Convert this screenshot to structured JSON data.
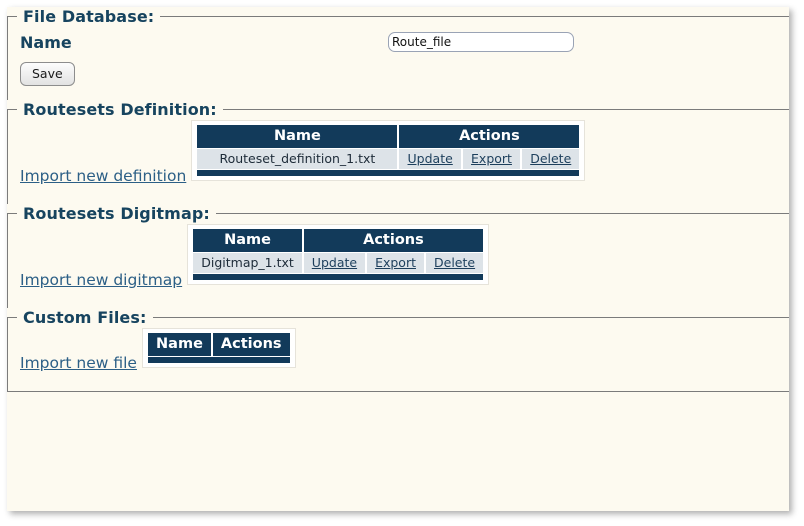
{
  "page": {
    "background": "#fdfaf0",
    "accent_navy": "#123a5a",
    "link_color": "#2c5f86"
  },
  "sections": {
    "file_database": {
      "title": "File Database:",
      "name_label": "Name",
      "name_value": "Route_file",
      "name_placeholder": "",
      "save_label": "Save"
    },
    "routesets_definition": {
      "title": "Routesets Definition:",
      "import_link": "Import new definition",
      "columns": [
        "Name",
        "Actions"
      ],
      "rows": [
        {
          "name": "Routeset_definition_1.txt",
          "actions": [
            "Update",
            "Export",
            "Delete"
          ]
        }
      ]
    },
    "routesets_digitmap": {
      "title": "Routesets Digitmap:",
      "import_link": "Import new digitmap",
      "columns": [
        "Name",
        "Actions"
      ],
      "rows": [
        {
          "name": "Digitmap_1.txt",
          "actions": [
            "Update",
            "Export",
            "Delete"
          ]
        }
      ]
    },
    "custom_files": {
      "title": "Custom Files:",
      "import_link": "Import new file",
      "columns": [
        "Name",
        "Actions"
      ],
      "rows": []
    }
  }
}
